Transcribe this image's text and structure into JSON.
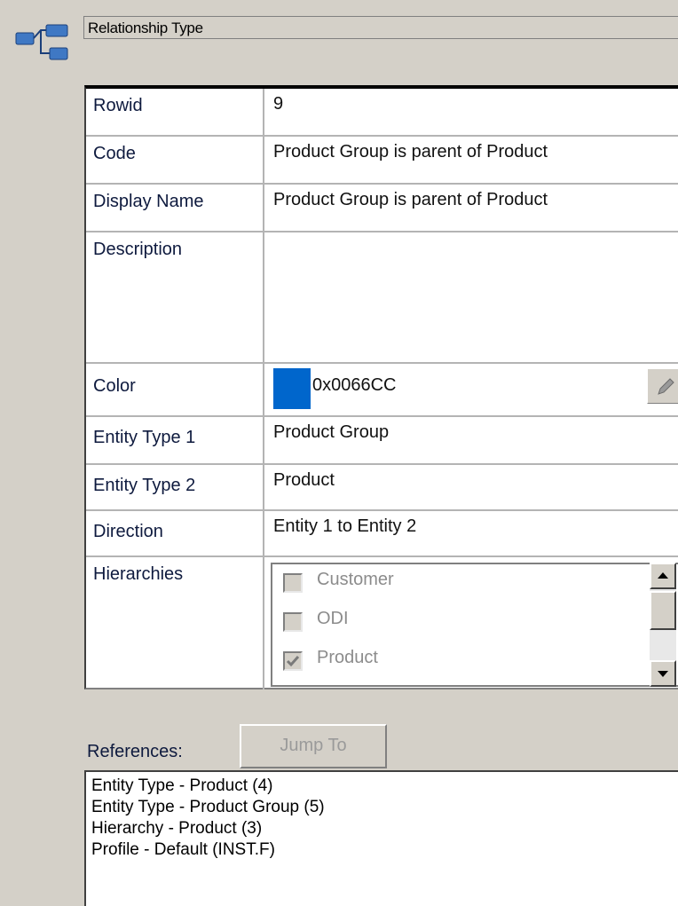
{
  "header": {
    "title": "Relationship Type",
    "icon": "relationship-icon"
  },
  "properties": {
    "rowid": {
      "label": "Rowid",
      "value": "9"
    },
    "code": {
      "label": "Code",
      "value": "Product Group is parent of Product"
    },
    "display_name": {
      "label": "Display Name",
      "value": "Product Group is parent of Product"
    },
    "description": {
      "label": "Description",
      "value": ""
    },
    "color": {
      "label": "Color",
      "value": "0x0066CC",
      "swatch": "#0066CC"
    },
    "entity_type_1": {
      "label": "Entity Type 1",
      "value": "Product Group"
    },
    "entity_type_2": {
      "label": "Entity Type 2",
      "value": "Product"
    },
    "direction": {
      "label": "Direction",
      "value": "Entity 1 to Entity 2"
    },
    "hierarchies": {
      "label": "Hierarchies",
      "items": [
        {
          "label": "Customer",
          "checked": false
        },
        {
          "label": "ODI",
          "checked": false
        },
        {
          "label": "Product",
          "checked": true
        }
      ]
    }
  },
  "references": {
    "label": "References:",
    "jump_label": "Jump To",
    "items": [
      "Entity Type - Product (4)",
      "Entity Type - Product Group (5)",
      "Hierarchy - Product (3)",
      "Profile - Default (INST.F)"
    ]
  }
}
